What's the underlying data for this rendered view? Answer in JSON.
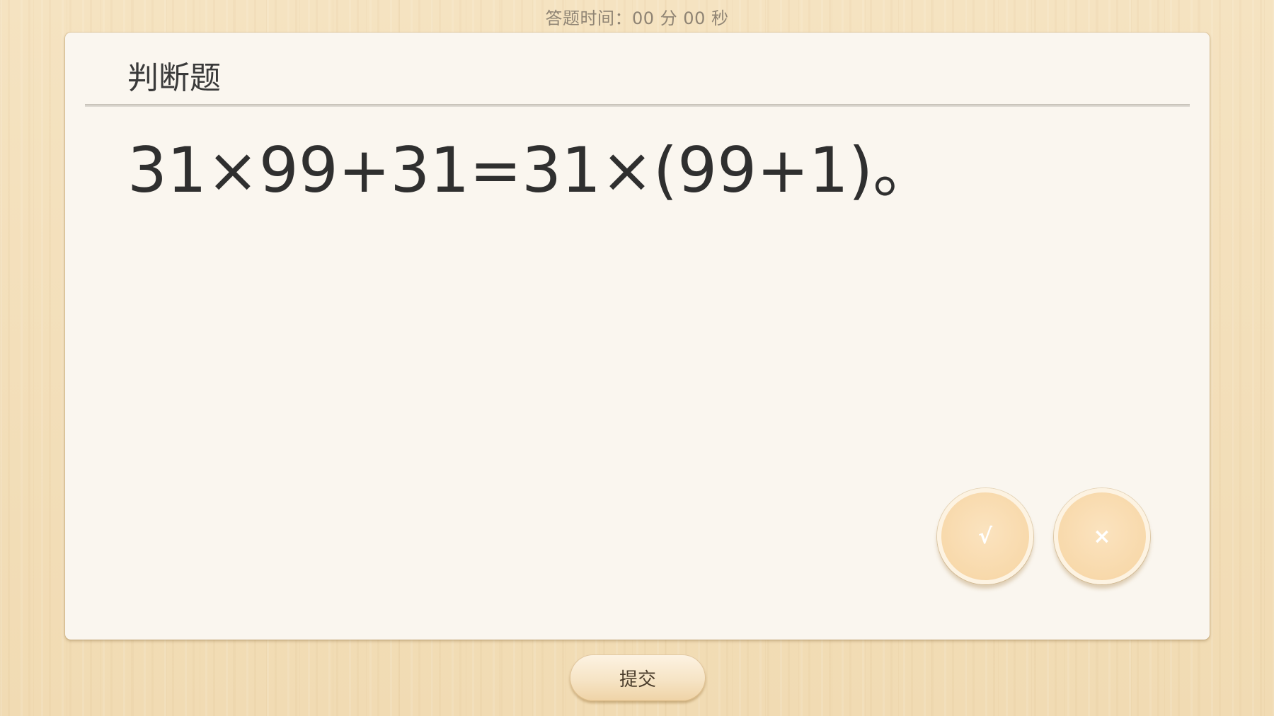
{
  "header": {
    "timer_text": "答题时间：00 分 00 秒"
  },
  "card": {
    "title": "判断题",
    "question": "31×99+31=31×(99+1)。"
  },
  "answers": {
    "true_label": "√",
    "false_label": "×"
  },
  "footer": {
    "submit_label": "提交"
  },
  "colors": {
    "background": "#f3dfb9",
    "card": "#faf6ef",
    "answer_button": "#f8d9ab",
    "text": "#2f2f2f"
  }
}
